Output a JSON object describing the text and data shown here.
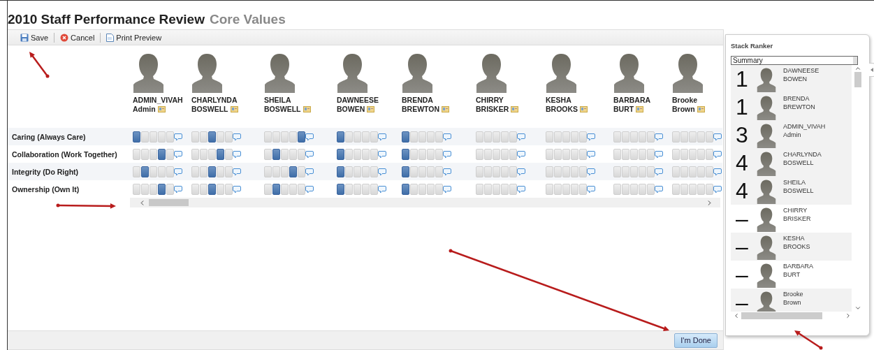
{
  "title": {
    "main": "2010 Staff Performance Review",
    "sub": "Core Values"
  },
  "toolbar": [
    {
      "kind": "save",
      "label": "Save"
    },
    {
      "kind": "cancel",
      "label": "Cancel"
    },
    {
      "kind": "print",
      "label": "Print Preview"
    }
  ],
  "criteria": [
    "Caring (Always Care)",
    "Collaboration (Work Together)",
    "Integrity (Do Right)",
    "Ownership (Own It)"
  ],
  "people": [
    {
      "first": "ADMIN_VIVAH",
      "last": "Admin",
      "ratings": [
        [
          {
            "selected": true
          },
          {
            "selected": false
          },
          {
            "selected": false
          },
          {
            "selected": false
          },
          {
            "selected": false
          }
        ],
        [
          {
            "selected": false
          },
          {
            "selected": false
          },
          {
            "selected": false
          },
          {
            "selected": true
          },
          {
            "selected": false
          }
        ],
        [
          {
            "selected": false
          },
          {
            "selected": true
          },
          {
            "selected": false
          },
          {
            "selected": false
          },
          {
            "selected": false
          }
        ],
        [
          {
            "selected": false
          },
          {
            "selected": false
          },
          {
            "selected": false
          },
          {
            "selected": true
          },
          {
            "selected": false
          }
        ]
      ]
    },
    {
      "first": "CHARLYNDA",
      "last": "BOSWELL",
      "ratings": [
        [
          {
            "selected": false
          },
          {
            "selected": false
          },
          {
            "selected": true
          },
          {
            "selected": false
          },
          {
            "selected": false
          }
        ],
        [
          {
            "selected": false
          },
          {
            "selected": false
          },
          {
            "selected": false
          },
          {
            "selected": true
          },
          {
            "selected": false
          }
        ],
        [
          {
            "selected": false
          },
          {
            "selected": false
          },
          {
            "selected": true
          },
          {
            "selected": false
          },
          {
            "selected": false
          }
        ],
        [
          {
            "selected": false
          },
          {
            "selected": false
          },
          {
            "selected": true
          },
          {
            "selected": false
          },
          {
            "selected": false
          }
        ]
      ]
    },
    {
      "first": "SHEILA",
      "last": "BOSWELL",
      "ratings": [
        [
          {
            "selected": false
          },
          {
            "selected": false
          },
          {
            "selected": false
          },
          {
            "selected": false
          },
          {
            "selected": true
          }
        ],
        [
          {
            "selected": false
          },
          {
            "selected": true
          },
          {
            "selected": false
          },
          {
            "selected": false
          },
          {
            "selected": false
          }
        ],
        [
          {
            "selected": false
          },
          {
            "selected": false
          },
          {
            "selected": false
          },
          {
            "selected": true
          },
          {
            "selected": false
          }
        ],
        [
          {
            "selected": false
          },
          {
            "selected": true
          },
          {
            "selected": false
          },
          {
            "selected": false
          },
          {
            "selected": false
          }
        ]
      ]
    },
    {
      "first": "DAWNEESE",
      "last": "BOWEN",
      "ratings": [
        [
          {
            "selected": true
          },
          {
            "selected": false
          },
          {
            "selected": false
          },
          {
            "selected": false
          },
          {
            "selected": false
          }
        ],
        [
          {
            "selected": true
          },
          {
            "selected": false
          },
          {
            "selected": false
          },
          {
            "selected": false
          },
          {
            "selected": false
          }
        ],
        [
          {
            "selected": true
          },
          {
            "selected": false
          },
          {
            "selected": false
          },
          {
            "selected": false
          },
          {
            "selected": false
          }
        ],
        [
          {
            "selected": true
          },
          {
            "selected": false
          },
          {
            "selected": false
          },
          {
            "selected": false
          },
          {
            "selected": false
          }
        ]
      ]
    },
    {
      "first": "BRENDA",
      "last": "BREWTON",
      "ratings": [
        [
          {
            "selected": true
          },
          {
            "selected": false
          },
          {
            "selected": false
          },
          {
            "selected": false
          },
          {
            "selected": false
          }
        ],
        [
          {
            "selected": true
          },
          {
            "selected": false
          },
          {
            "selected": false
          },
          {
            "selected": false
          },
          {
            "selected": false
          }
        ],
        [
          {
            "selected": true
          },
          {
            "selected": false
          },
          {
            "selected": false
          },
          {
            "selected": false
          },
          {
            "selected": false
          }
        ],
        [
          {
            "selected": true
          },
          {
            "selected": false
          },
          {
            "selected": false
          },
          {
            "selected": false
          },
          {
            "selected": false
          }
        ]
      ]
    },
    {
      "first": "CHIRRY",
      "last": "BRISKER",
      "ratings": [
        [
          {
            "selected": false
          },
          {
            "selected": false
          },
          {
            "selected": false
          },
          {
            "selected": false
          },
          {
            "selected": false
          }
        ],
        [
          {
            "selected": false
          },
          {
            "selected": false
          },
          {
            "selected": false
          },
          {
            "selected": false
          },
          {
            "selected": false
          }
        ],
        [
          {
            "selected": false
          },
          {
            "selected": false
          },
          {
            "selected": false
          },
          {
            "selected": false
          },
          {
            "selected": false
          }
        ],
        [
          {
            "selected": false
          },
          {
            "selected": false
          },
          {
            "selected": false
          },
          {
            "selected": false
          },
          {
            "selected": false
          }
        ]
      ]
    },
    {
      "first": "KESHA",
      "last": "BROOKS",
      "ratings": [
        [
          {
            "selected": false
          },
          {
            "selected": false
          },
          {
            "selected": false
          },
          {
            "selected": false
          },
          {
            "selected": false
          }
        ],
        [
          {
            "selected": false
          },
          {
            "selected": false
          },
          {
            "selected": false
          },
          {
            "selected": false
          },
          {
            "selected": false
          }
        ],
        [
          {
            "selected": false
          },
          {
            "selected": false
          },
          {
            "selected": false
          },
          {
            "selected": false
          },
          {
            "selected": false
          }
        ],
        [
          {
            "selected": false
          },
          {
            "selected": false
          },
          {
            "selected": false
          },
          {
            "selected": false
          },
          {
            "selected": false
          }
        ]
      ]
    },
    {
      "first": "BARBARA",
      "last": "BURT",
      "ratings": [
        [
          {
            "selected": false
          },
          {
            "selected": false
          },
          {
            "selected": false
          },
          {
            "selected": false
          },
          {
            "selected": false
          }
        ],
        [
          {
            "selected": false
          },
          {
            "selected": false
          },
          {
            "selected": false
          },
          {
            "selected": false
          },
          {
            "selected": false
          }
        ],
        [
          {
            "selected": false
          },
          {
            "selected": false
          },
          {
            "selected": false
          },
          {
            "selected": false
          },
          {
            "selected": false
          }
        ],
        [
          {
            "selected": false
          },
          {
            "selected": false
          },
          {
            "selected": false
          },
          {
            "selected": false
          },
          {
            "selected": false
          }
        ]
      ]
    },
    {
      "first": "Brooke",
      "last": "Brown",
      "ratings": [
        [
          {
            "selected": false
          },
          {
            "selected": false
          },
          {
            "selected": false
          },
          {
            "selected": false
          },
          {
            "selected": false
          }
        ],
        [
          {
            "selected": false
          },
          {
            "selected": false
          },
          {
            "selected": false
          },
          {
            "selected": false
          },
          {
            "selected": false
          }
        ],
        [
          {
            "selected": false
          },
          {
            "selected": false
          },
          {
            "selected": false
          },
          {
            "selected": false
          },
          {
            "selected": false
          }
        ],
        [
          {
            "selected": false
          },
          {
            "selected": false
          },
          {
            "selected": false
          },
          {
            "selected": false
          },
          {
            "selected": false
          }
        ]
      ]
    }
  ],
  "done_button": "I'm Done",
  "stack_ranker": {
    "title": "Stack Ranker",
    "select": "Summary",
    "items": [
      {
        "rank": "1",
        "first": "DAWNEESE",
        "last": "BOWEN"
      },
      {
        "rank": "1",
        "first": "BRENDA",
        "last": "BREWTON"
      },
      {
        "rank": "3",
        "first": "ADMIN_VIVAH",
        "last": "Admin"
      },
      {
        "rank": "4",
        "first": "CHARLYNDA",
        "last": "BOSWELL"
      },
      {
        "rank": "4",
        "first": "SHEILA",
        "last": "BOSWELL"
      },
      {
        "rank": "–",
        "first": "CHIRRY",
        "last": "BRISKER"
      },
      {
        "rank": "–",
        "first": "KESHA",
        "last": "BROOKS"
      },
      {
        "rank": "–",
        "first": "BARBARA",
        "last": "BURT"
      },
      {
        "rank": "–",
        "first": "Brooke",
        "last": "Brown"
      }
    ]
  }
}
